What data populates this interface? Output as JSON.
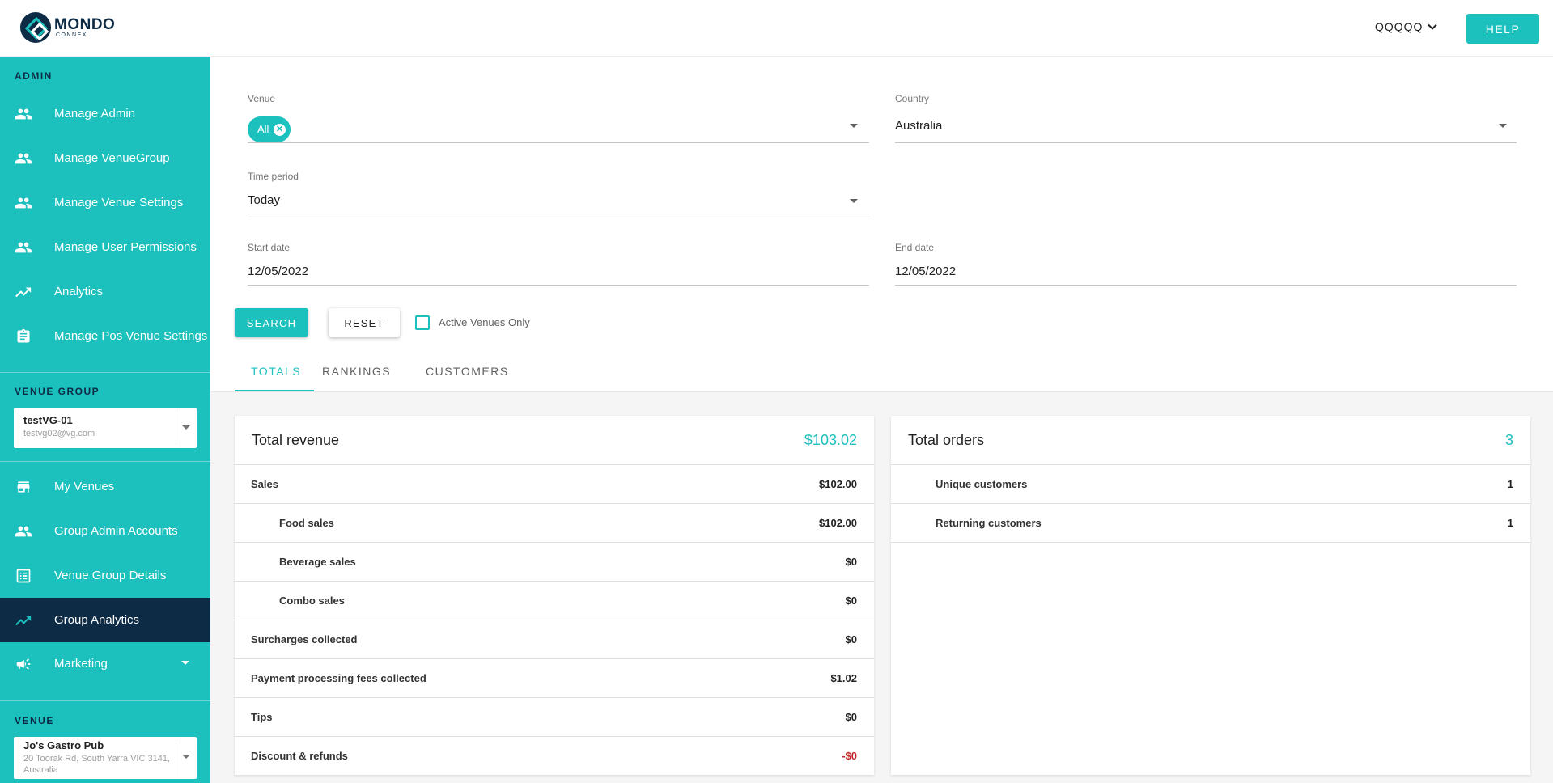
{
  "header": {
    "logo_main": "MONDO",
    "logo_sub": "CONNEX",
    "user_name": "QQQQQ",
    "help_label": "HELP"
  },
  "sidebar": {
    "admin_title": "ADMIN",
    "admin_items": [
      {
        "label": "Manage Admin",
        "icon": "people-icon"
      },
      {
        "label": "Manage VenueGroup",
        "icon": "people-icon"
      },
      {
        "label": "Manage Venue Settings",
        "icon": "people-icon"
      },
      {
        "label": "Manage User Permissions",
        "icon": "people-icon"
      },
      {
        "label": "Analytics",
        "icon": "trending-up-icon"
      },
      {
        "label": "Manage Pos Venue Settings",
        "icon": "clipboard-icon"
      }
    ],
    "venue_group_title": "VENUE GROUP",
    "venue_group_select": {
      "name": "testVG-01",
      "email": "testvg02@vg.com"
    },
    "group_items": [
      {
        "label": "My Venues",
        "icon": "store-icon"
      },
      {
        "label": "Group Admin Accounts",
        "icon": "people-icon"
      },
      {
        "label": "Venue Group Details",
        "icon": "list-icon"
      },
      {
        "label": "Group Analytics",
        "icon": "trending-up-icon",
        "active": true
      },
      {
        "label": "Marketing",
        "icon": "megaphone-icon"
      }
    ],
    "venue_title": "VENUE",
    "venue_select": {
      "name": "Jo's Gastro Pub",
      "address": "20 Toorak Rd, South Yarra VIC 3141, Australia"
    }
  },
  "filters": {
    "venue_label": "Venue",
    "venue_chip": "All",
    "country_label": "Country",
    "country_value": "Australia",
    "time_period_label": "Time period",
    "time_period_value": "Today",
    "start_date_label": "Start date",
    "start_date_value": "12/05/2022",
    "end_date_label": "End date",
    "end_date_value": "12/05/2022",
    "search_label": "SEARCH",
    "reset_label": "RESET",
    "active_only_label": "Active Venues Only",
    "active_only_checked": false
  },
  "tabs": [
    "TOTALS",
    "RANKINGS",
    "CUSTOMERS"
  ],
  "active_tab": "TOTALS",
  "revenue_card": {
    "title": "Total revenue",
    "total": "$103.02",
    "rows": [
      {
        "label": "Sales",
        "value": "$102.00",
        "indent": false
      },
      {
        "label": "Food sales",
        "value": "$102.00",
        "indent": true
      },
      {
        "label": "Beverage sales",
        "value": "$0",
        "indent": true
      },
      {
        "label": "Combo sales",
        "value": "$0",
        "indent": true
      },
      {
        "label": "Surcharges collected",
        "value": "$0",
        "indent": false
      },
      {
        "label": "Payment processing fees collected",
        "value": "$1.02",
        "indent": false
      },
      {
        "label": "Tips",
        "value": "$0",
        "indent": false
      },
      {
        "label": "Discount & refunds",
        "value": "-$0",
        "indent": false,
        "negative": true
      }
    ]
  },
  "orders_card": {
    "title": "Total orders",
    "total": "3",
    "rows": [
      {
        "label": "Unique customers",
        "value": "1"
      },
      {
        "label": "Returning customers",
        "value": "1"
      }
    ]
  },
  "colors": {
    "accent": "#1cc0bd",
    "navy": "#0d2b45",
    "negative": "#c62828"
  }
}
